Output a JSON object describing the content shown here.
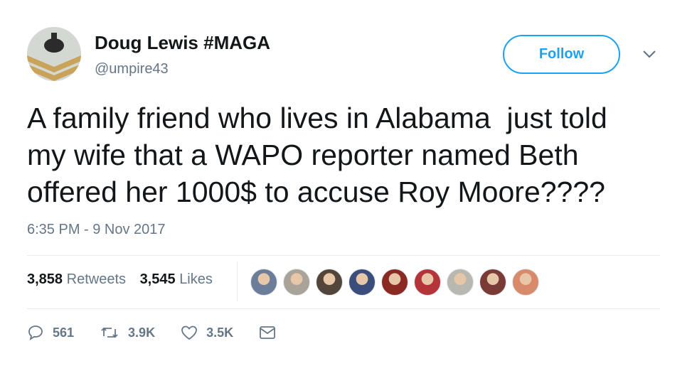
{
  "user": {
    "display_name": "Doug Lewis #MAGA",
    "handle": "@umpire43"
  },
  "follow_button": {
    "label": "Follow"
  },
  "tweet": {
    "text": "A family friend who lives in Alabama  just told\nmy wife that a WAPO reporter named Beth\noffered her 1000$ to accuse Roy Moore????",
    "timestamp": "6:35 PM - 9 Nov 2017"
  },
  "stats": {
    "retweets_count": "3,858",
    "retweets_label": "Retweets",
    "likes_count": "3,545",
    "likes_label": "Likes"
  },
  "liker_avatars": [
    "#6b7d99",
    "#a9a39a",
    "#54453a",
    "#3b4d7a",
    "#8a2a22",
    "#b5343a",
    "#b8b8b0",
    "#7a3a35",
    "#d98a6a"
  ],
  "actions": {
    "reply_count": "561",
    "retweet_count": "3.9K",
    "like_count": "3.5K"
  },
  "colors": {
    "accent": "#1da1f2",
    "muted": "#657786",
    "text": "#14171a"
  }
}
